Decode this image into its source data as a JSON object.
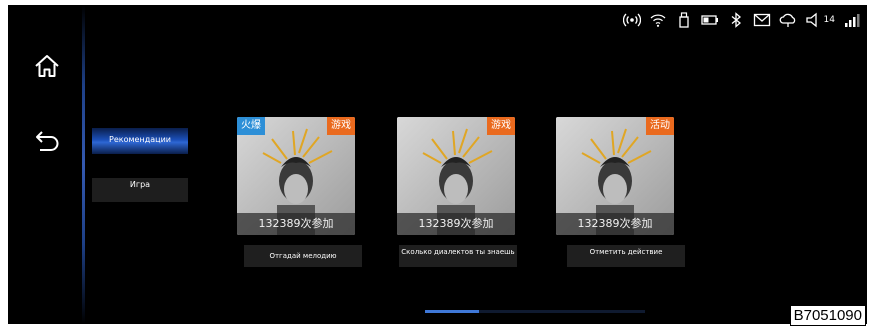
{
  "status_bar": {
    "icons": [
      "hotspot-icon",
      "wifi-icon",
      "usb-icon",
      "battery-icon",
      "bluetooth-icon",
      "message-icon",
      "cloud-icon",
      "volume-icon",
      "signal-icon"
    ],
    "volume_level": "14"
  },
  "nav": {
    "home_icon": "home-icon",
    "back_icon": "back-icon"
  },
  "categories": [
    {
      "label": "Рекомендации",
      "selected": true
    },
    {
      "label": "Игра",
      "selected": false
    }
  ],
  "cards": [
    {
      "left_badge": "火爆",
      "right_badge": "游戏",
      "count": "132389次参加",
      "title": "Отгадай мелодию"
    },
    {
      "left_badge": "",
      "right_badge": "游戏",
      "count": "132389次参加",
      "title": "Сколько диалектов ты знаешь"
    },
    {
      "left_badge": "",
      "right_badge": "活动",
      "count": "132389次参加",
      "title": "Отметить действие"
    }
  ],
  "colors": {
    "accent_blue": "#2e67d4",
    "badge_hot": "#2d8fd7",
    "badge_type": "#ea6a1e"
  },
  "scroll": {
    "position_fraction": 0.25
  },
  "watermark": "B7051090"
}
